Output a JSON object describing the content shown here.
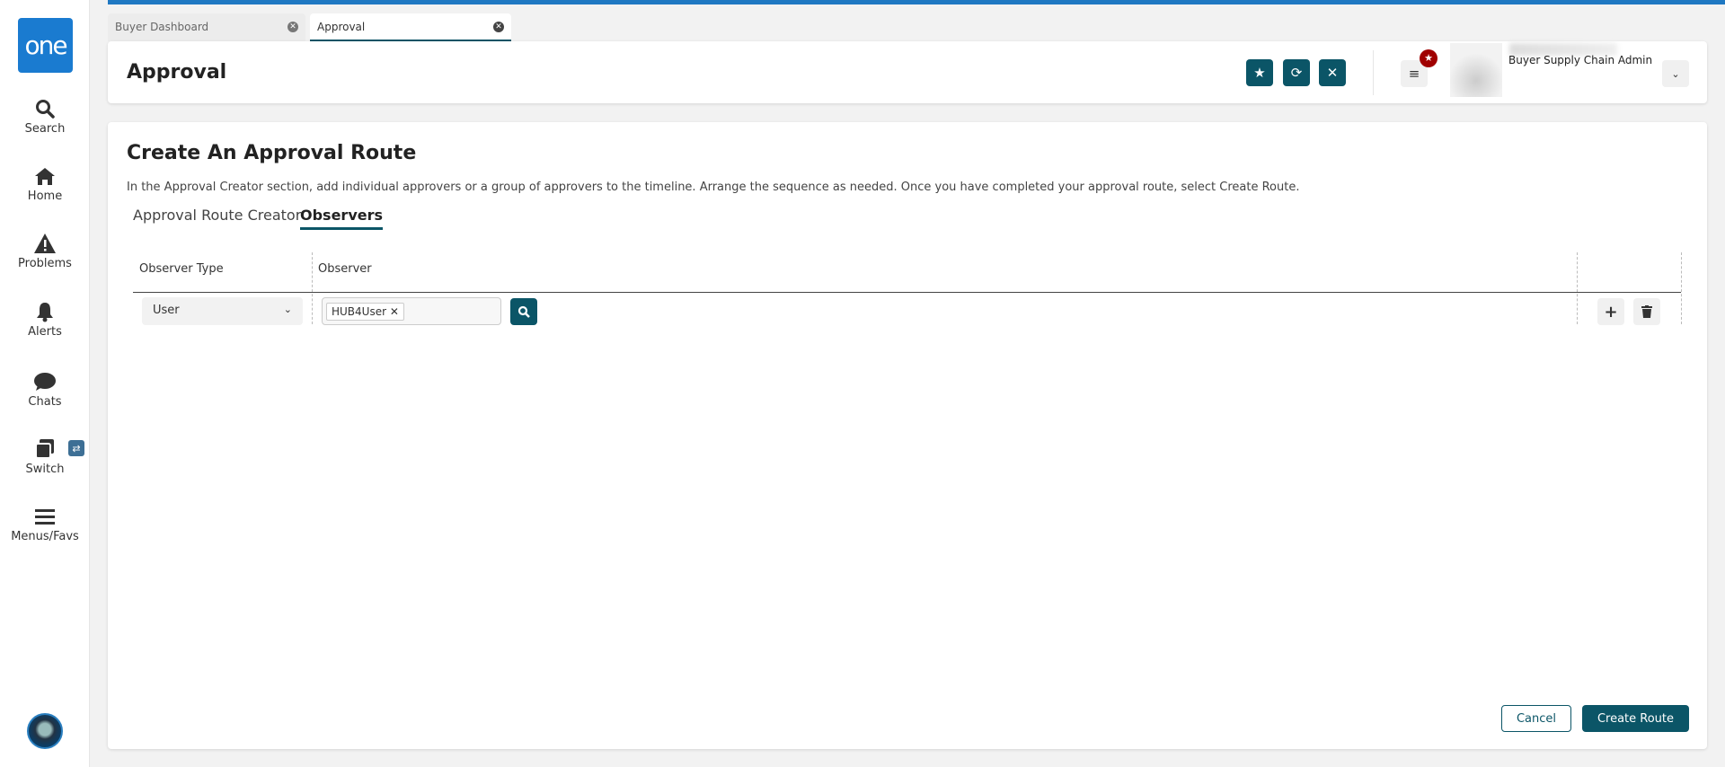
{
  "sidebar": {
    "logo": "one",
    "items": [
      {
        "label": "Search",
        "icon": "search-icon"
      },
      {
        "label": "Home",
        "icon": "home-icon"
      },
      {
        "label": "Problems",
        "icon": "warning-icon"
      },
      {
        "label": "Alerts",
        "icon": "bell-icon"
      },
      {
        "label": "Chats",
        "icon": "chat-icon"
      },
      {
        "label": "Switch",
        "icon": "switch-icon"
      },
      {
        "label": "Menus/Favs",
        "icon": "menu-icon"
      }
    ]
  },
  "tabs": [
    {
      "label": "Buyer Dashboard",
      "active": false
    },
    {
      "label": "Approval",
      "active": true
    }
  ],
  "header": {
    "title": "Approval",
    "role": "Buyer Supply Chain Admin"
  },
  "main": {
    "title": "Create An Approval Route",
    "description": "In the Approval Creator section, add individual approvers or a group of approvers to the timeline. Arrange the sequence as needed. Once you have completed your approval route, select Create Route.",
    "subtabs": [
      {
        "label": "Approval Route Creator",
        "active": false
      },
      {
        "label": "Observers",
        "active": true
      }
    ],
    "table": {
      "headers": [
        "Observer Type",
        "Observer"
      ],
      "rows": [
        {
          "observer_type": "User",
          "observers": [
            "HUB4User"
          ]
        }
      ]
    },
    "cancel_label": "Cancel",
    "create_label": "Create Route"
  },
  "colors": {
    "accent": "#0b5567",
    "brand": "#1a7bd0",
    "badge": "#a00000"
  }
}
